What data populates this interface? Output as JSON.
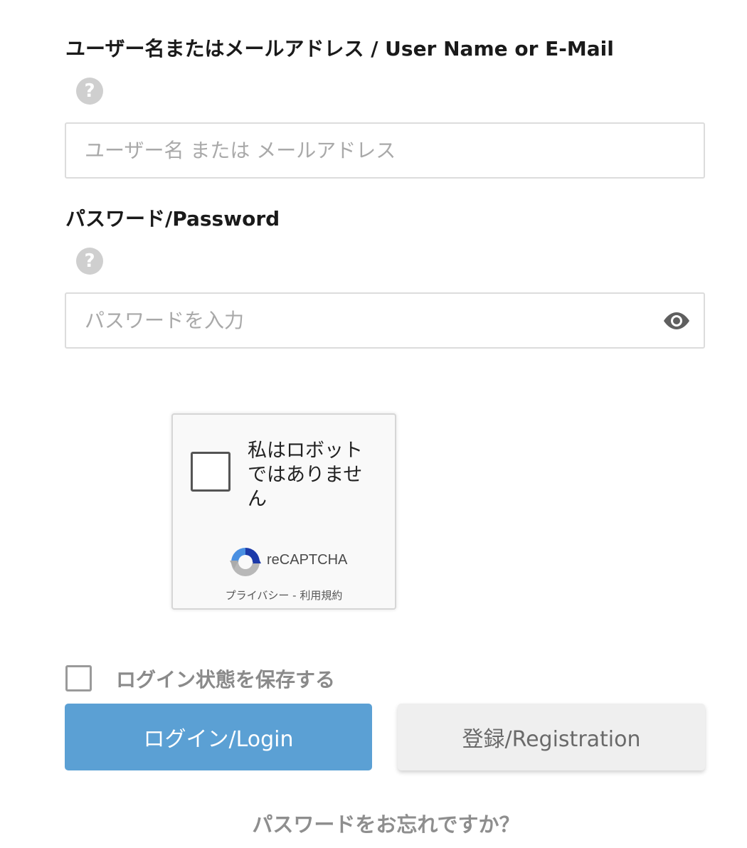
{
  "username": {
    "label": "ユーザー名またはメールアドレス / User Name or E-Mail",
    "help_glyph": "?",
    "placeholder": "ユーザー名 または メールアドレス",
    "value": ""
  },
  "password": {
    "label": "パスワード/Password",
    "help_glyph": "?",
    "placeholder": "パスワードを入力",
    "value": "",
    "toggle_icon": "eye-icon"
  },
  "recaptcha": {
    "checkbox_text": "私はロボットではありません",
    "brand": "reCAPTCHA",
    "privacy_link": "プライバシー",
    "separator": " - ",
    "terms_link": "利用規約"
  },
  "remember": {
    "label": "ログイン状態を保存する",
    "checked": false
  },
  "buttons": {
    "login": "ログイン/Login",
    "register": "登録/Registration"
  },
  "forgot_password": "パスワードをお忘れですか？",
  "colors": {
    "login_button": "#5ba0d4",
    "register_button": "#efefef",
    "help_icon": "#cfcfcf",
    "input_border": "#dcdcdc"
  }
}
